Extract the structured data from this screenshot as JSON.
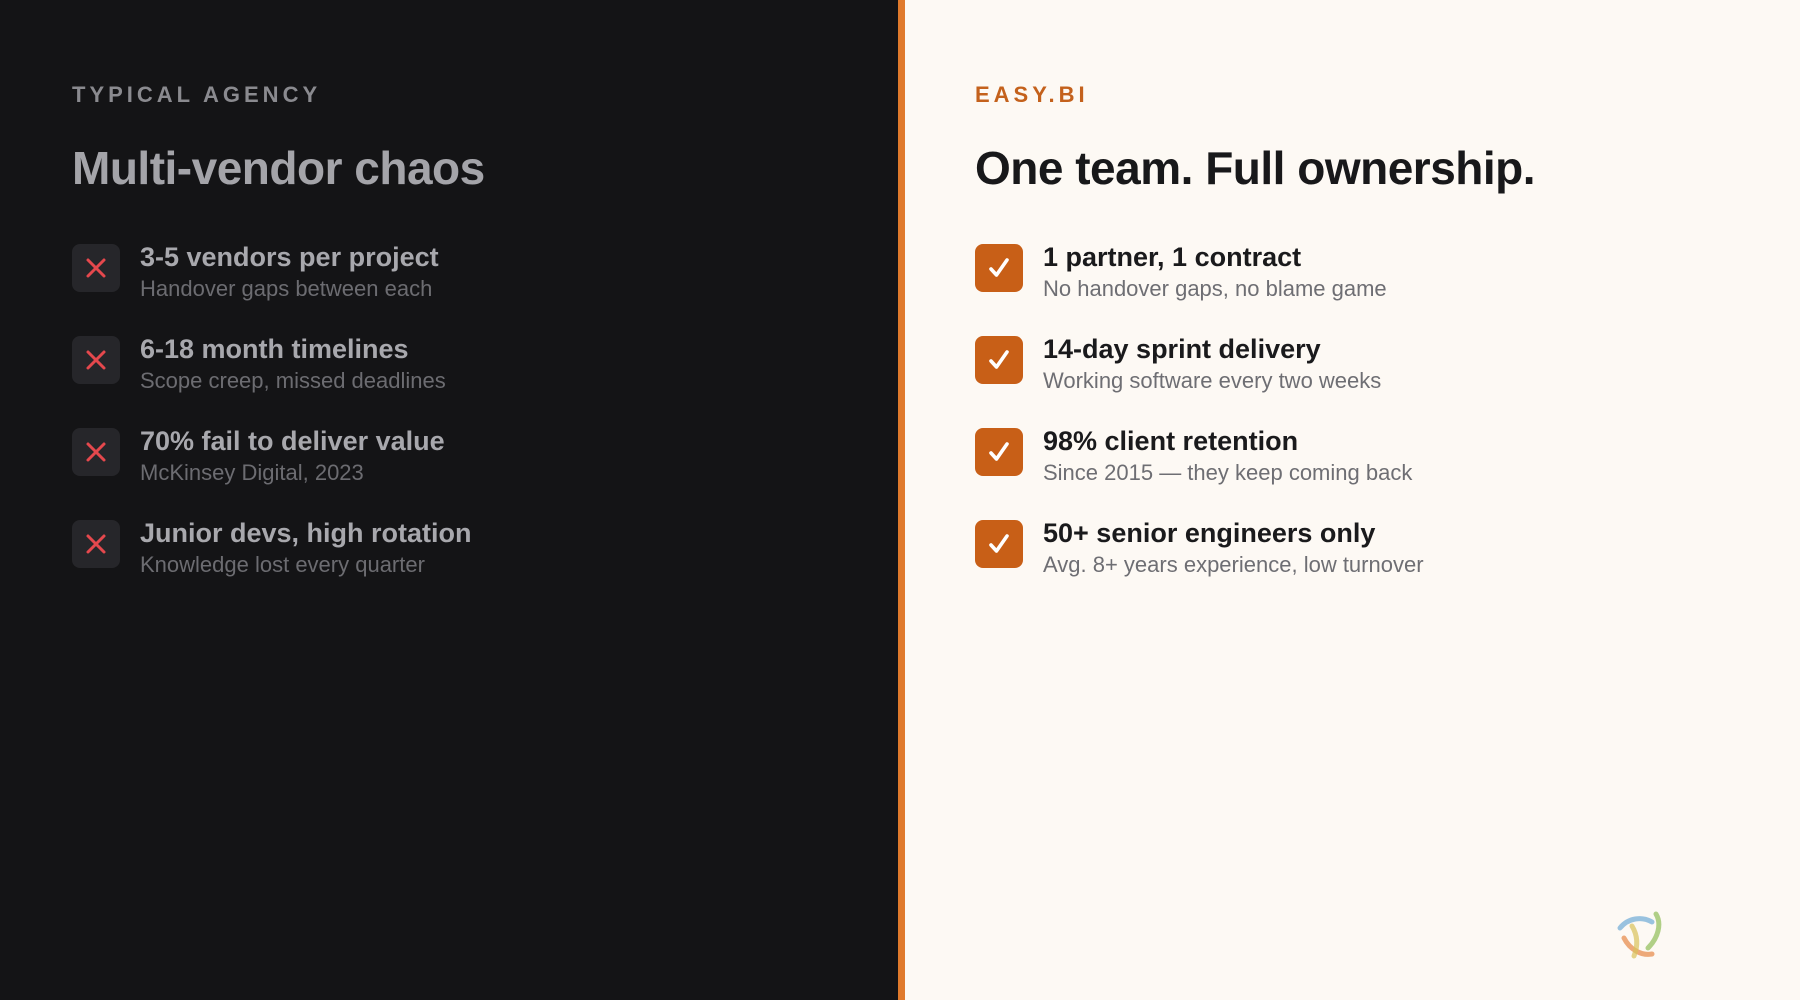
{
  "left": {
    "eyebrow": "TYPICAL AGENCY",
    "headline": "Multi-vendor chaos",
    "items": [
      {
        "title": "3-5 vendors per project",
        "subtitle": "Handover gaps between each"
      },
      {
        "title": "6-18 month timelines",
        "subtitle": "Scope creep, missed deadlines"
      },
      {
        "title": "70% fail to deliver value",
        "subtitle": "McKinsey Digital, 2023"
      },
      {
        "title": "Junior devs, high rotation",
        "subtitle": "Knowledge lost every quarter"
      }
    ],
    "icon": "x-icon"
  },
  "right": {
    "eyebrow": "EASY.BI",
    "headline": "One team. Full ownership.",
    "items": [
      {
        "title": "1 partner, 1 contract",
        "subtitle": "No handover gaps, no blame game"
      },
      {
        "title": "14-day sprint delivery",
        "subtitle": "Working software every two weeks"
      },
      {
        "title": "98% client retention",
        "subtitle": "Since 2015 — they keep coming back"
      },
      {
        "title": "50+ senior engineers only",
        "subtitle": "Avg. 8+ years experience, low turnover"
      }
    ],
    "icon": "check-icon"
  },
  "colors": {
    "left_bg": "#141416",
    "right_bg": "#fdf9f4",
    "accent": "#e07a2c",
    "x_red": "#e5484d",
    "check_badge": "#c85f17"
  }
}
